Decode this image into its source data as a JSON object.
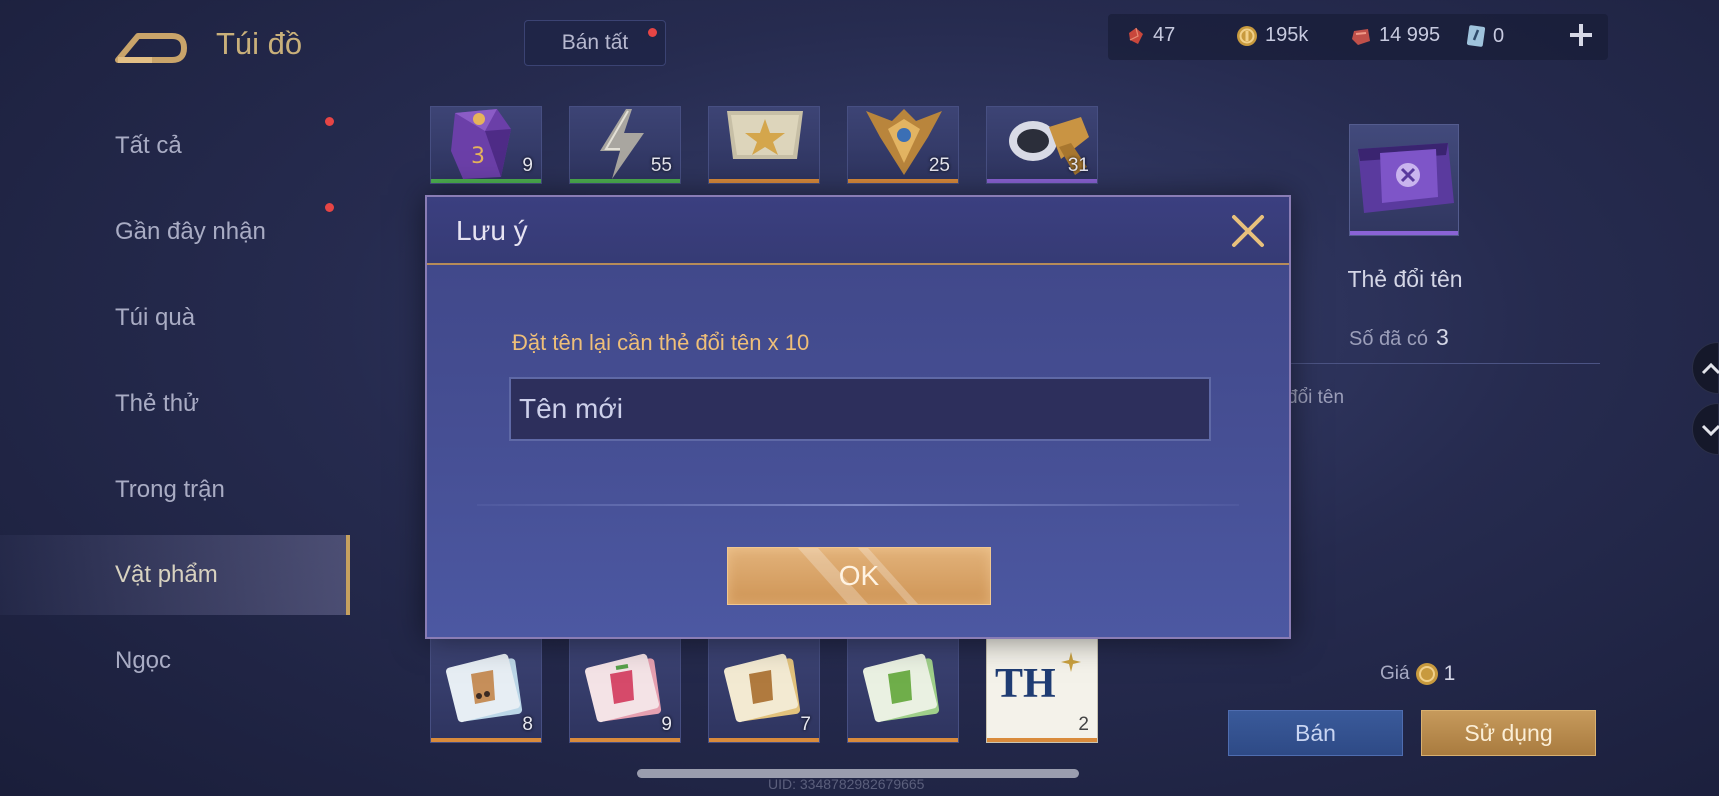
{
  "header": {
    "title": "Túi đồ",
    "sell_all_label": "Bán tất",
    "currencies": [
      {
        "icon": "red-gem-icon",
        "value": "47"
      },
      {
        "icon": "gold-coin-icon",
        "value": "195k"
      },
      {
        "icon": "ruby-icon",
        "value": "14 995"
      },
      {
        "icon": "card-icon",
        "value": "0"
      }
    ]
  },
  "sidebar": {
    "items": [
      {
        "label": "Tất cả"
      },
      {
        "label": "Gần đây nhận"
      },
      {
        "label": "Túi quà"
      },
      {
        "label": "Thẻ thử"
      },
      {
        "label": "Trong trận"
      },
      {
        "label": "Vật phẩm"
      },
      {
        "label": "Ngọc"
      }
    ],
    "active": "Vật phẩm"
  },
  "grid": {
    "top_row": [
      {
        "icon": "dice-icon",
        "count": "9",
        "rarity_color": "#4caf50"
      },
      {
        "icon": "lightning-icon",
        "count": "55",
        "rarity_color": "#4caf50"
      },
      {
        "icon": "star-badge-icon",
        "count": "",
        "rarity_color": "#d98b3c"
      },
      {
        "icon": "rank-emblem-icon",
        "count": "25",
        "rarity_color": "#d98b3c"
      },
      {
        "icon": "horn-icon",
        "count": "31",
        "rarity_color": "#8a63d6"
      }
    ],
    "bottom_row": [
      {
        "icon": "bubble-tea-card-icon",
        "count": "8",
        "rarity_color": "#d98b3c"
      },
      {
        "icon": "strawberry-drink-card-icon",
        "count": "9",
        "rarity_color": "#d98b3c"
      },
      {
        "icon": "coffee-card-icon",
        "count": "7",
        "rarity_color": "#d98b3c"
      },
      {
        "icon": "matcha-card-icon",
        "count": "",
        "rarity_color": "#d98b3c"
      },
      {
        "icon": "th-logo-icon",
        "label": "TH",
        "count": "2",
        "rarity_color": "#d98b3c"
      }
    ]
  },
  "detail": {
    "item_name": "Thẻ đổi tên",
    "owned_label": "Số đã có",
    "owned_value": "3",
    "description": "đổi tên",
    "price_label": "Giá",
    "price_value": "1",
    "sell_label": "Bán",
    "use_label": "Sử dụng"
  },
  "dialog": {
    "title": "Lưu ý",
    "hint": "Đặt tên lại cần thẻ đổi tên x 10",
    "input_value": "Tên mới",
    "ok_label": "OK"
  },
  "footer": {
    "uid_text": "UID: 3348782982679665"
  },
  "colors": {
    "accent_gold": "#c9b07a",
    "dialog_hint": "#efbf78",
    "red_dot": "#e64545"
  }
}
